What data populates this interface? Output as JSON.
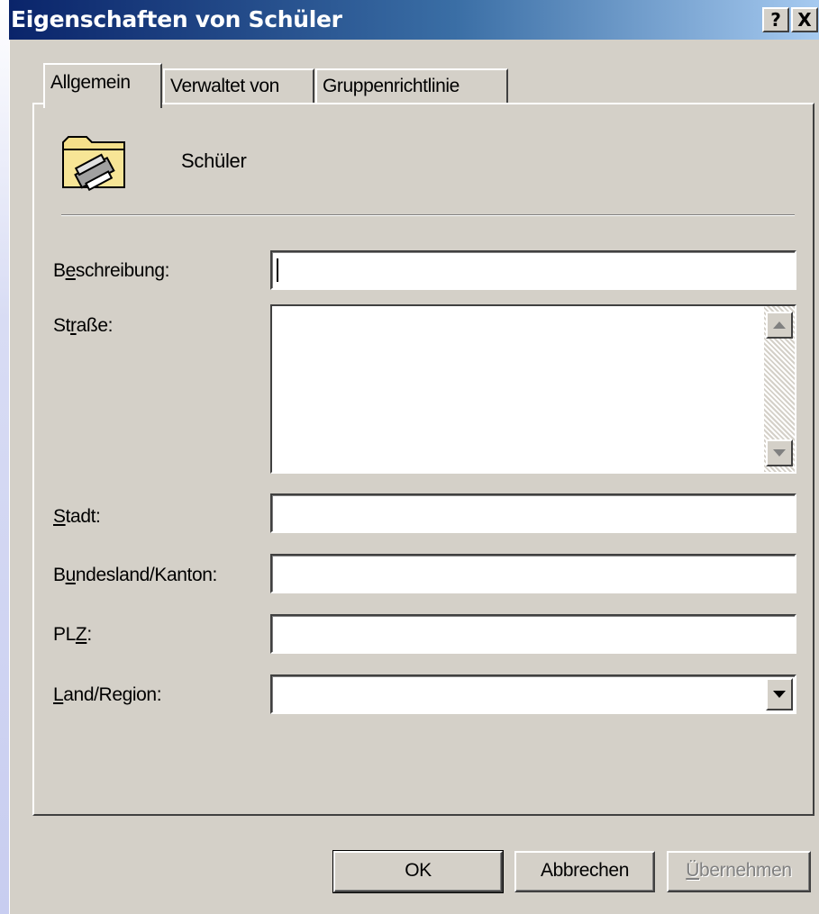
{
  "window": {
    "title": "Eigenschaften von Schüler",
    "help_button": "?",
    "close_button": "X"
  },
  "tabs": [
    {
      "label": "Allgemein",
      "active": true
    },
    {
      "label": "Verwaltet von",
      "active": false
    },
    {
      "label": "Gruppenrichtlinie",
      "active": false
    }
  ],
  "object": {
    "icon": "organizational-unit-folder-icon",
    "name": "Schüler"
  },
  "form": {
    "beschreibung": {
      "label_pre": "B",
      "label_key": "e",
      "label_post": "schreibung:",
      "value": ""
    },
    "strasse": {
      "label_pre": "St",
      "label_key": "r",
      "label_post": "aße:",
      "value": ""
    },
    "stadt": {
      "label_pre": "",
      "label_key": "S",
      "label_post": "tadt:",
      "value": ""
    },
    "bundesland": {
      "label_pre": "B",
      "label_key": "u",
      "label_post": "ndesland/Kanton:",
      "value": ""
    },
    "plz": {
      "label_pre": "PL",
      "label_key": "Z",
      "label_post": ":",
      "value": ""
    },
    "land": {
      "label_pre": "",
      "label_key": "L",
      "label_post": "and/Region:",
      "selected": ""
    }
  },
  "buttons": {
    "ok": "OK",
    "cancel": "Abbrechen",
    "apply_key": "Ü",
    "apply_rest": "bernehmen",
    "apply_enabled": false
  }
}
